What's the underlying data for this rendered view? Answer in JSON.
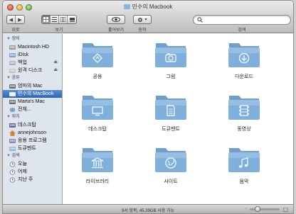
{
  "window": {
    "title": "민수의 Macbook"
  },
  "toolbar": {
    "back_label": "◀",
    "forward_label": "▶",
    "nav_caption": "위로",
    "view_caption": "보기",
    "quicklook_caption": "훑어보기",
    "action_caption": "동작",
    "search_caption": "검색",
    "action_arrow": "▾"
  },
  "search": {
    "value": ""
  },
  "sidebar": {
    "sections": [
      {
        "header": "▼ 장비",
        "items": [
          {
            "label": "Macintosh HD",
            "icon": "hard-drive-icon"
          },
          {
            "label": "iDisk",
            "icon": "idisk-icon"
          },
          {
            "label": "백업",
            "icon": "backup-drive-icon",
            "eject": "⏏"
          },
          {
            "label": "원격 디스크",
            "icon": "remote-disc-icon",
            "eject": "⏏"
          }
        ]
      },
      {
        "header": "▼ 공유",
        "items": [
          {
            "label": "엄마의 Mac",
            "icon": "shared-mac-icon"
          },
          {
            "label": "민수의 MacBook",
            "icon": "shared-macbook-icon",
            "selected": true
          },
          {
            "label": "Marta's Mac",
            "icon": "shared-mac-icon"
          },
          {
            "label": "전체...",
            "icon": "network-icon"
          }
        ]
      },
      {
        "header": "▼ 위치",
        "items": [
          {
            "label": "데스크탑",
            "icon": "desktop-icon"
          },
          {
            "label": "annejohnson",
            "icon": "home-icon"
          },
          {
            "label": "응용 프로그램",
            "icon": "applications-icon"
          },
          {
            "label": "도큐멘트",
            "icon": "documents-icon"
          }
        ]
      },
      {
        "header": "▼ 검색",
        "items": [
          {
            "label": "오늘",
            "icon": "clock-icon"
          },
          {
            "label": "어제",
            "icon": "clock-icon"
          },
          {
            "label": "지난 주",
            "icon": "clock-icon"
          }
        ]
      }
    ]
  },
  "folders": [
    {
      "label": "공용",
      "icon": "public-folder-icon"
    },
    {
      "label": "그림",
      "icon": "pictures-folder-icon"
    },
    {
      "label": "다운로드",
      "icon": "downloads-folder-icon"
    },
    {
      "label": "데스크탑",
      "icon": "desktop-folder-icon"
    },
    {
      "label": "도큐멘트",
      "icon": "documents-folder-icon"
    },
    {
      "label": "동영상",
      "icon": "movies-folder-icon"
    },
    {
      "label": "라이브러리",
      "icon": "library-folder-icon"
    },
    {
      "label": "사이트",
      "icon": "sites-folder-icon"
    },
    {
      "label": "음악",
      "icon": "music-folder-icon"
    }
  ],
  "status": {
    "text": "9서 항목, 45.39GB 사용 가능"
  },
  "colors": {
    "folder": "#7fb0dc",
    "selection": "#2e64b3",
    "sidebar_bg": "#dfe5ed"
  }
}
